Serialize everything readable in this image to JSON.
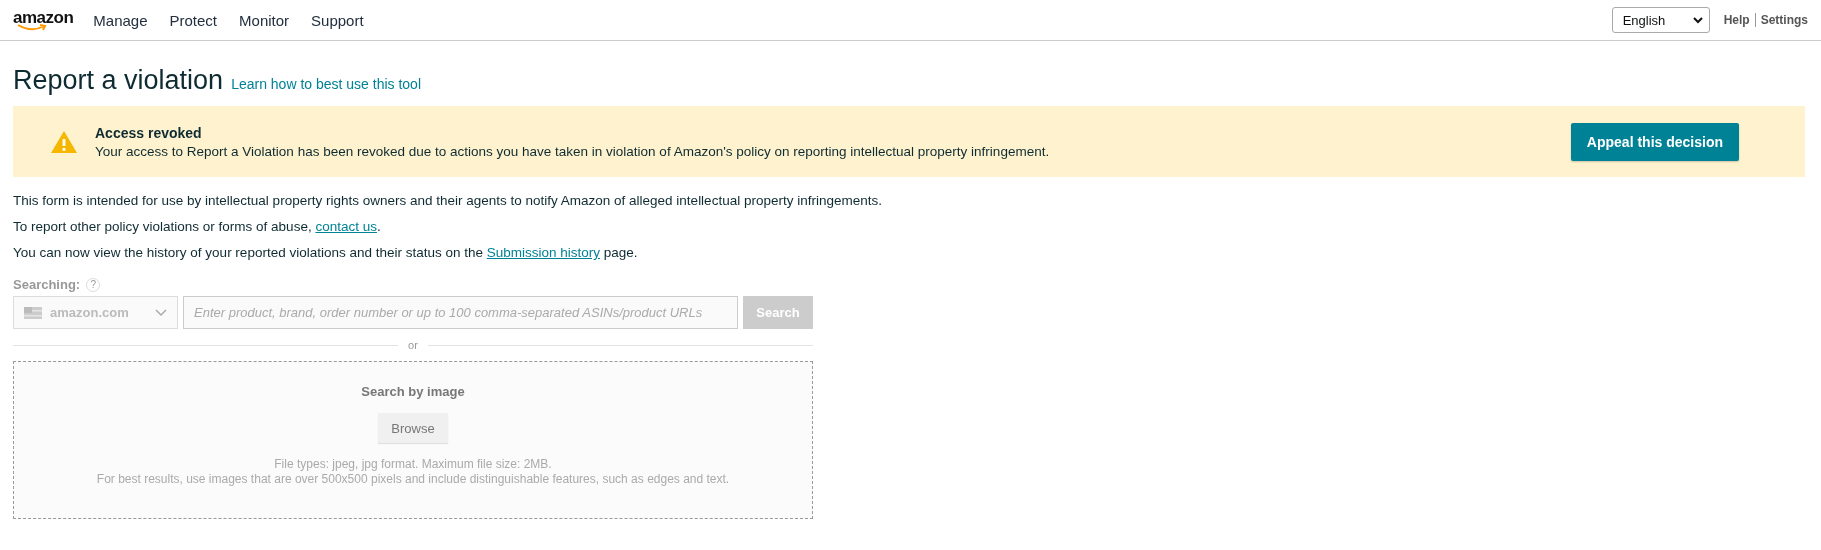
{
  "nav": {
    "logo": "amazon",
    "items": [
      {
        "label": "Manage"
      },
      {
        "label": "Protect"
      },
      {
        "label": "Monitor"
      },
      {
        "label": "Support"
      }
    ],
    "language": "English",
    "help": "Help",
    "settings": "Settings"
  },
  "header": {
    "title": "Report a violation",
    "link": "Learn how to best use this tool"
  },
  "alert": {
    "title": "Access revoked",
    "message": "Your access to Report a Violation has been revoked due to actions you have taken in violation of Amazon's policy on reporting intellectual property infringement.",
    "button": "Appeal this decision"
  },
  "intro": [
    {
      "before": "This form is intended for use by intellectual property rights owners and their agents to notify Amazon of alleged intellectual property infringements."
    },
    {
      "before": "To report other policy violations or forms of abuse, ",
      "link": "contact us",
      "after": "."
    },
    {
      "before": "You can now view the history of your reported violations and their status on the ",
      "link": "Submission history",
      "after": " page."
    }
  ],
  "search": {
    "disabled": true,
    "label": "Searching:",
    "help": "?",
    "marketplace": "amazon.com",
    "placeholder": "Enter product, brand, order number or up to 100 comma-separated ASINs/product URLs",
    "button": "Search",
    "divider": "or"
  },
  "image_search": {
    "title": "Search by image",
    "button": "Browse",
    "hint_1": "File types: jpeg, jpg format. Maximum file size: 2MB.",
    "hint_2": "For best results, use images that are over 500x500 pixels and include distinguishable features, such as edges and text."
  }
}
